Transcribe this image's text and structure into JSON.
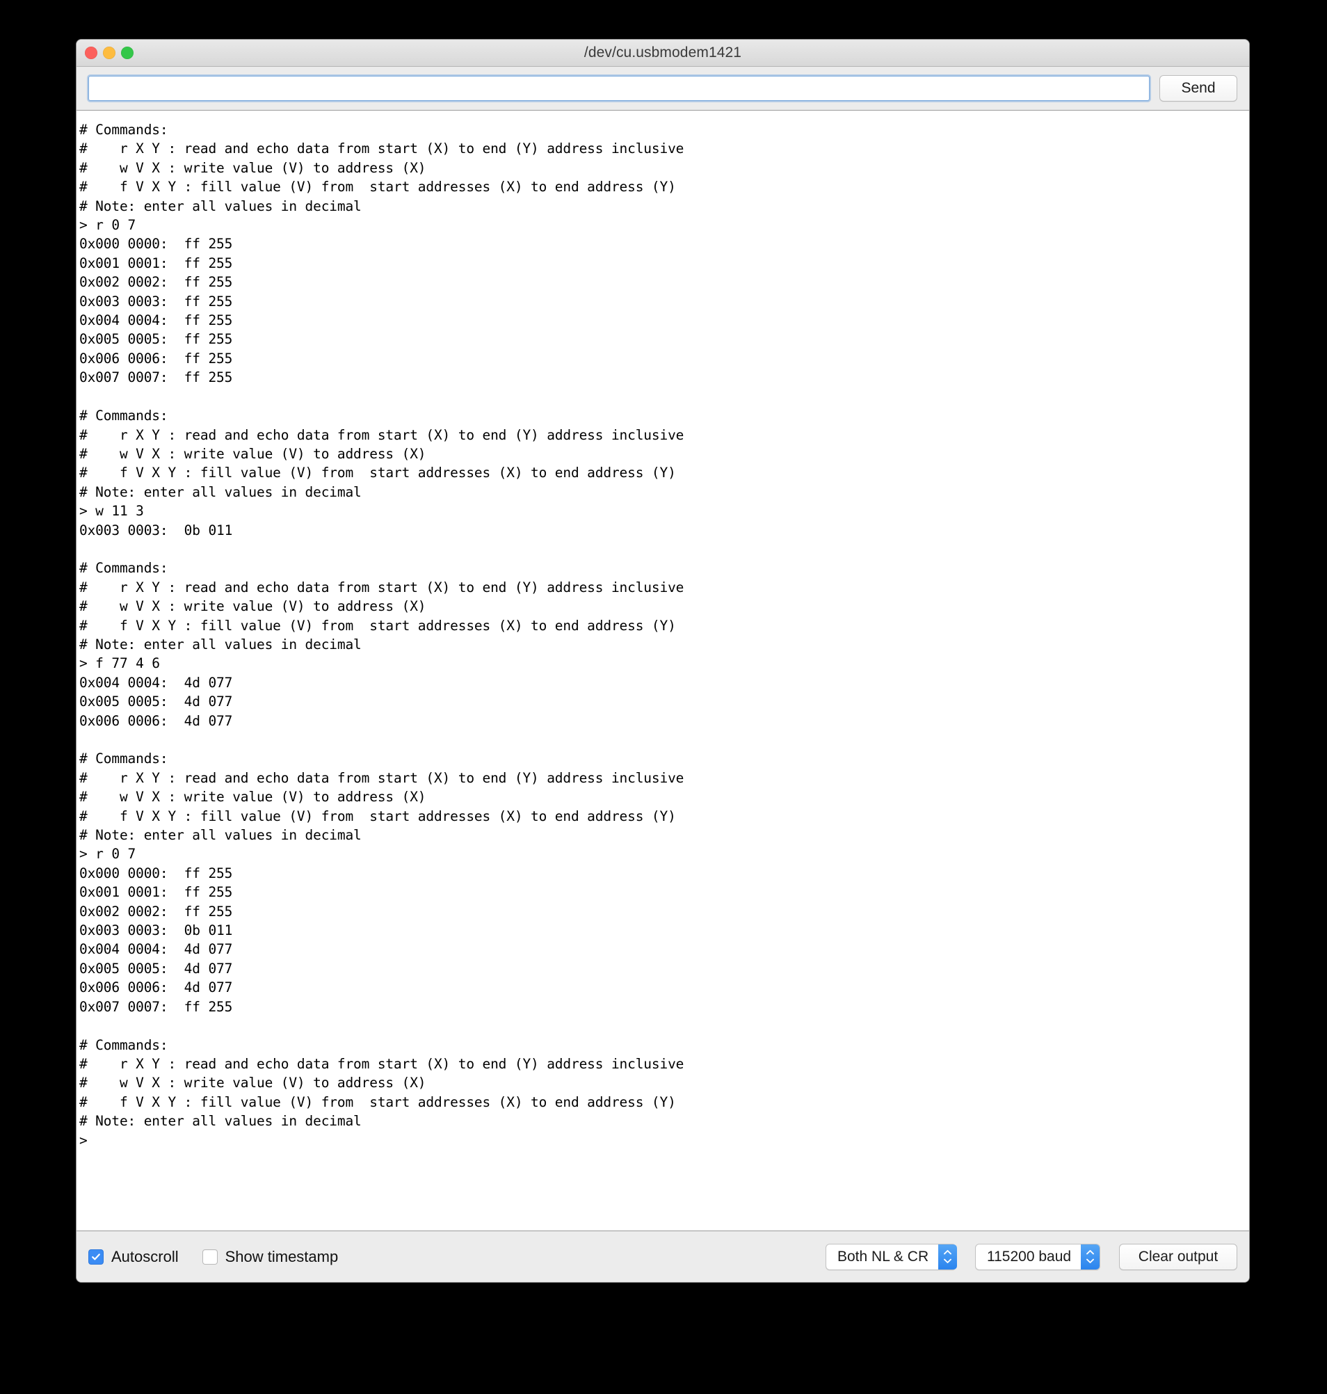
{
  "window": {
    "title": "/dev/cu.usbmodem1421",
    "traffic_lights": {
      "close": "close-button",
      "minimize": "minimize-button",
      "maximize": "maximize-button"
    },
    "colors": {
      "close": "#fc605c",
      "minimize": "#fdbc40",
      "maximize": "#34c749",
      "accent": "#3b8cf4",
      "focus_ring": "#7aa9dd",
      "titlebar_bg": "#e4e4e4",
      "chrome_bg": "#ececec",
      "console_bg": "#ffffff",
      "console_fg": "#000000"
    }
  },
  "send_bar": {
    "input_value": "",
    "input_placeholder": "",
    "send_label": "Send"
  },
  "console": {
    "text": "# Commands:\n#    r X Y : read and echo data from start (X) to end (Y) address inclusive\n#    w V X : write value (V) to address (X)\n#    f V X Y : fill value (V) from  start addresses (X) to end address (Y)\n# Note: enter all values in decimal\n> r 0 7\n0x000 0000:  ff 255\n0x001 0001:  ff 255\n0x002 0002:  ff 255\n0x003 0003:  ff 255\n0x004 0004:  ff 255\n0x005 0005:  ff 255\n0x006 0006:  ff 255\n0x007 0007:  ff 255\n\n# Commands:\n#    r X Y : read and echo data from start (X) to end (Y) address inclusive\n#    w V X : write value (V) to address (X)\n#    f V X Y : fill value (V) from  start addresses (X) to end address (Y)\n# Note: enter all values in decimal\n> w 11 3\n0x003 0003:  0b 011\n\n# Commands:\n#    r X Y : read and echo data from start (X) to end (Y) address inclusive\n#    w V X : write value (V) to address (X)\n#    f V X Y : fill value (V) from  start addresses (X) to end address (Y)\n# Note: enter all values in decimal\n> f 77 4 6\n0x004 0004:  4d 077\n0x005 0005:  4d 077\n0x006 0006:  4d 077\n\n# Commands:\n#    r X Y : read and echo data from start (X) to end (Y) address inclusive\n#    w V X : write value (V) to address (X)\n#    f V X Y : fill value (V) from  start addresses (X) to end address (Y)\n# Note: enter all values in decimal\n> r 0 7\n0x000 0000:  ff 255\n0x001 0001:  ff 255\n0x002 0002:  ff 255\n0x003 0003:  0b 011\n0x004 0004:  4d 077\n0x005 0005:  4d 077\n0x006 0006:  4d 077\n0x007 0007:  ff 255\n\n# Commands:\n#    r X Y : read and echo data from start (X) to end (Y) address inclusive\n#    w V X : write value (V) to address (X)\n#    f V X Y : fill value (V) from  start addresses (X) to end address (Y)\n# Note: enter all values in decimal\n>"
  },
  "bottom_bar": {
    "autoscroll_label": "Autoscroll",
    "autoscroll_checked": true,
    "show_timestamp_label": "Show timestamp",
    "show_timestamp_checked": false,
    "line_ending_value": "Both NL & CR",
    "baud_value": "115200 baud",
    "clear_output_label": "Clear output"
  }
}
